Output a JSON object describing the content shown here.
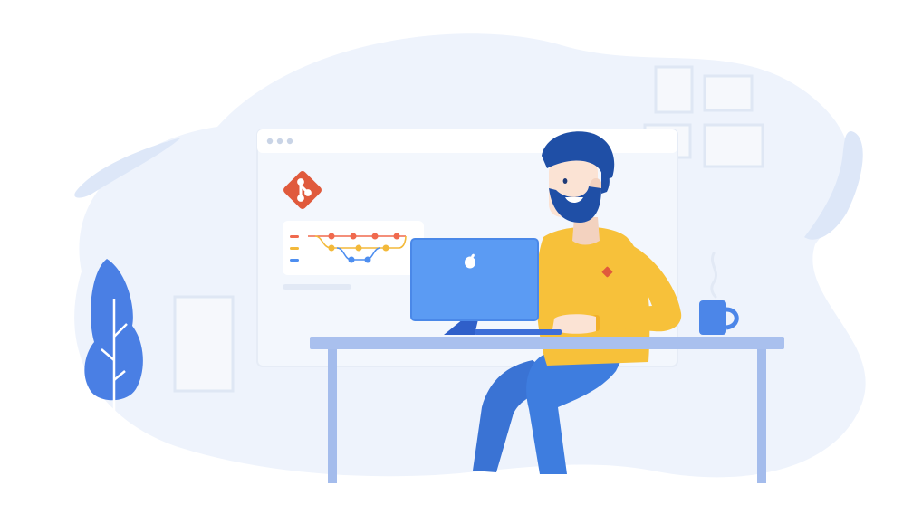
{
  "colors": {
    "background": "#ffffff",
    "blob": "#eef3fc",
    "wave": "#dde7f8",
    "browser_window": "#f3f7fd",
    "browser_titlebar": "#ffffff",
    "window_dots": "#c9d4e6",
    "git_logo": "#e05a3c",
    "panel": "#ffffff",
    "commit_red": "#f06a4e",
    "commit_yellow": "#f3b93a",
    "commit_blue": "#4d8ef0",
    "desk_top": "#a9c0ee",
    "desk_legs": "#a4bcec",
    "monitor_screen": "#5b9bf3",
    "monitor_stand": "#2f5fc9",
    "sweater": "#f7c13a",
    "pants": "#3e7ddf",
    "hair_beard": "#1f4fa6",
    "skin": "#fbe3d4",
    "mug": "#4c86e8",
    "plant": "#4a7fe4",
    "frame": "#e8eef8"
  },
  "icons": [
    "git-logo-icon",
    "apple-logo-icon",
    "window-dots-icon",
    "steam-icon"
  ]
}
